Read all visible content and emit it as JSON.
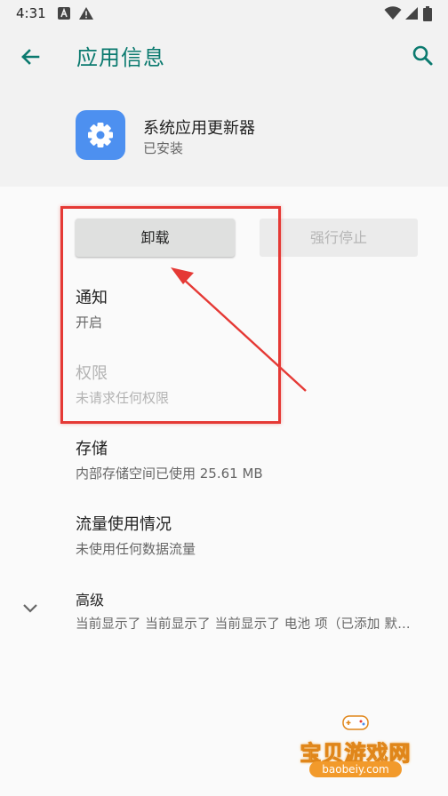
{
  "status_bar": {
    "time": "4:31"
  },
  "app_bar": {
    "title": "应用信息"
  },
  "app": {
    "name": "系统应用更新器",
    "status": "已安装"
  },
  "buttons": {
    "uninstall": "卸载",
    "force_stop": "强行停止"
  },
  "items": [
    {
      "title": "通知",
      "subtitle": "开启"
    },
    {
      "title": "权限",
      "subtitle": "未请求任何权限"
    },
    {
      "title": "存储",
      "subtitle": "内部存储空间已使用 25.61 MB"
    },
    {
      "title": "流量使用情况",
      "subtitle": "未使用任何数据流量"
    },
    {
      "title": "高级",
      "subtitle": "当前显示了 当前显示了 当前显示了 电池 项（已添加 默…"
    }
  ],
  "watermark": {
    "title": "宝贝游戏网",
    "url": "baobeiy.com"
  },
  "colors": {
    "accent": "#0b7a6f",
    "app_icon": "#4d90f0",
    "highlight": "#e53935",
    "watermark": "#f29a2b"
  },
  "icons": [
    "back-arrow-icon",
    "search-icon",
    "gear-icon",
    "chevron-down-icon",
    "wifi-icon",
    "battery-icon"
  ]
}
